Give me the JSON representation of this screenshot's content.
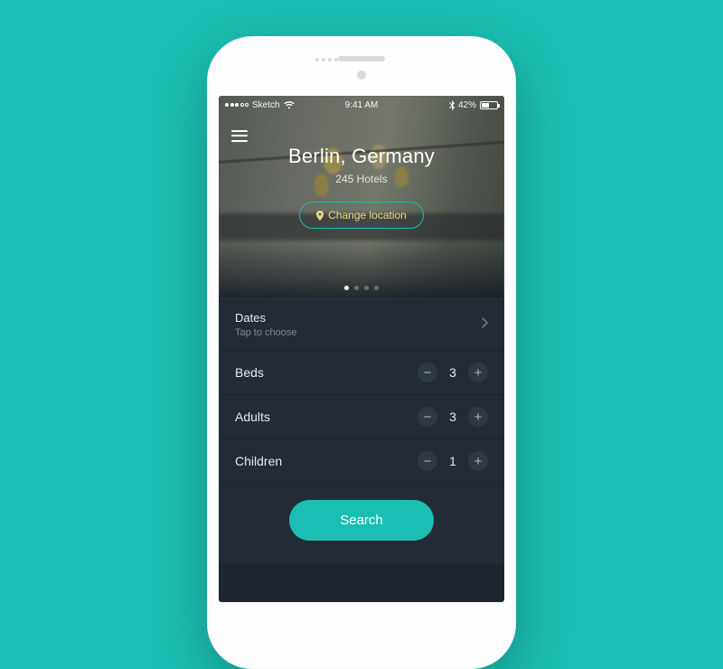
{
  "statusbar": {
    "carrier": "Sketch",
    "time": "9:41 AM",
    "battery_pct": "42%"
  },
  "hero": {
    "location_title": "Berlin, Germany",
    "hotels_count": "245 Hotels",
    "change_location_label": "Change location"
  },
  "dates": {
    "label": "Dates",
    "hint": "Tap to choose"
  },
  "steppers": {
    "beds": {
      "label": "Beds",
      "value": "3"
    },
    "adults": {
      "label": "Adults",
      "value": "3"
    },
    "children": {
      "label": "Children",
      "value": "1"
    }
  },
  "search_label": "Search"
}
